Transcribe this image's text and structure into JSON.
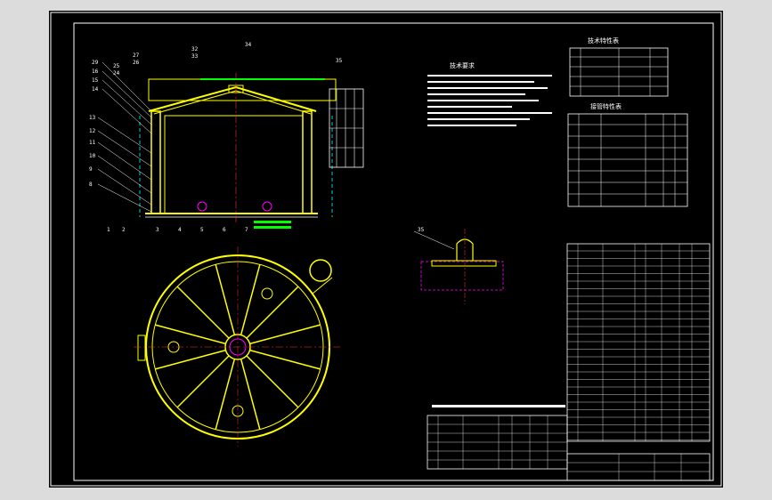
{
  "app": {
    "background": "#dcdcdc",
    "canvas_color": "#000000"
  },
  "drawing": {
    "tech_requirements_title": "技术要求",
    "tech_specs_title": "技术特性表",
    "nozzle_table_title": "接管特性表",
    "leader_numbers_left": [
      "29",
      "16",
      "15",
      "14",
      "13",
      "12",
      "11",
      "10",
      "9",
      "8"
    ],
    "leader_numbers_top": [
      "27",
      "26",
      "25",
      "24",
      "32",
      "33",
      "34",
      "35"
    ],
    "leader_numbers_bottom": [
      "1",
      "2",
      "3",
      "4",
      "5",
      "6",
      "7"
    ],
    "detail_label": "35",
    "colors": {
      "frame": "#ffffff",
      "outline": "#ffff00",
      "section": "#00ffff",
      "dimension": "#00ff00",
      "hidden": "#ff00ff",
      "text": "#ffffff",
      "accent_red": "#ff3030"
    }
  }
}
